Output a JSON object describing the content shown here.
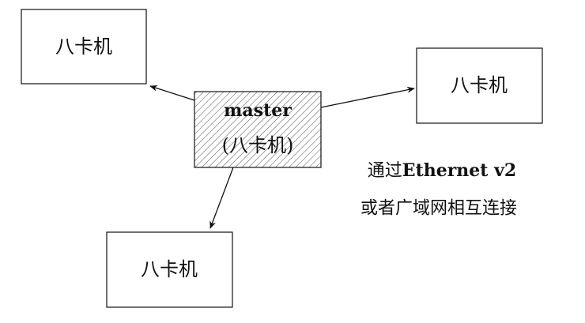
{
  "nodes": {
    "top_left": {
      "label": "八卡机"
    },
    "right": {
      "label": "八卡机"
    },
    "bottom": {
      "label": "八卡机"
    },
    "master": {
      "title": "master",
      "subtitle": "(八卡机)"
    }
  },
  "annotation": {
    "line1_prefix": "通过",
    "line1_bold": "Ethernet v2",
    "line2": "或者广域网相互连接"
  }
}
